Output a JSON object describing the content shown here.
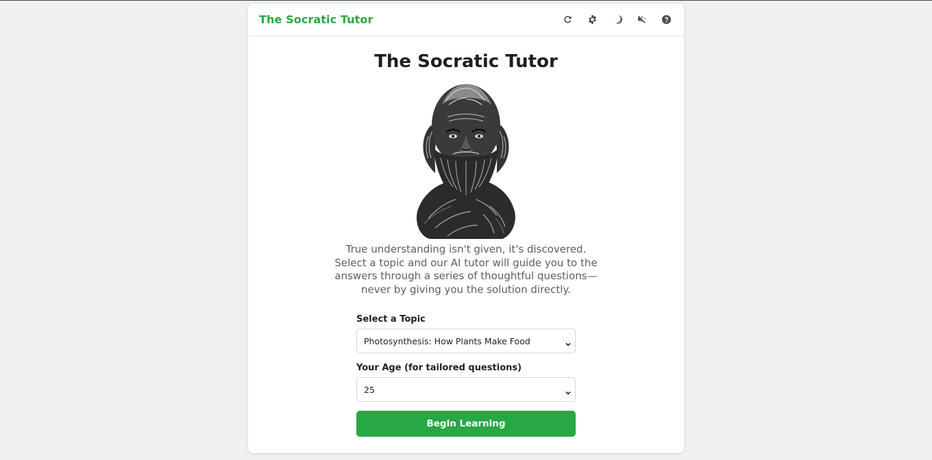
{
  "header": {
    "brand": "The Socratic Tutor",
    "tools": [
      {
        "icon": "refresh-icon"
      },
      {
        "icon": "gear-icon"
      },
      {
        "icon": "moon-icon"
      },
      {
        "icon": "mute-icon"
      },
      {
        "icon": "help-icon"
      }
    ]
  },
  "main": {
    "title": "The Socratic Tutor",
    "image_icon": "socrates-bust-illustration",
    "description": "True understanding isn't given, it's discovered. Select a topic and our AI tutor will guide you to the answers through a series of thoughtful questions—never by giving you the solution directly."
  },
  "form": {
    "topic_label": "Select a Topic",
    "topic_value": "Photosynthesis: How Plants Make Food",
    "age_label": "Your Age (for tailored questions)",
    "age_value": "25",
    "begin_label": "Begin Learning"
  },
  "colors": {
    "accent": "#28a745",
    "background": "#eef0f1",
    "card": "#ffffff",
    "text": "#1d1f21",
    "muted_text": "#5a5f64"
  }
}
